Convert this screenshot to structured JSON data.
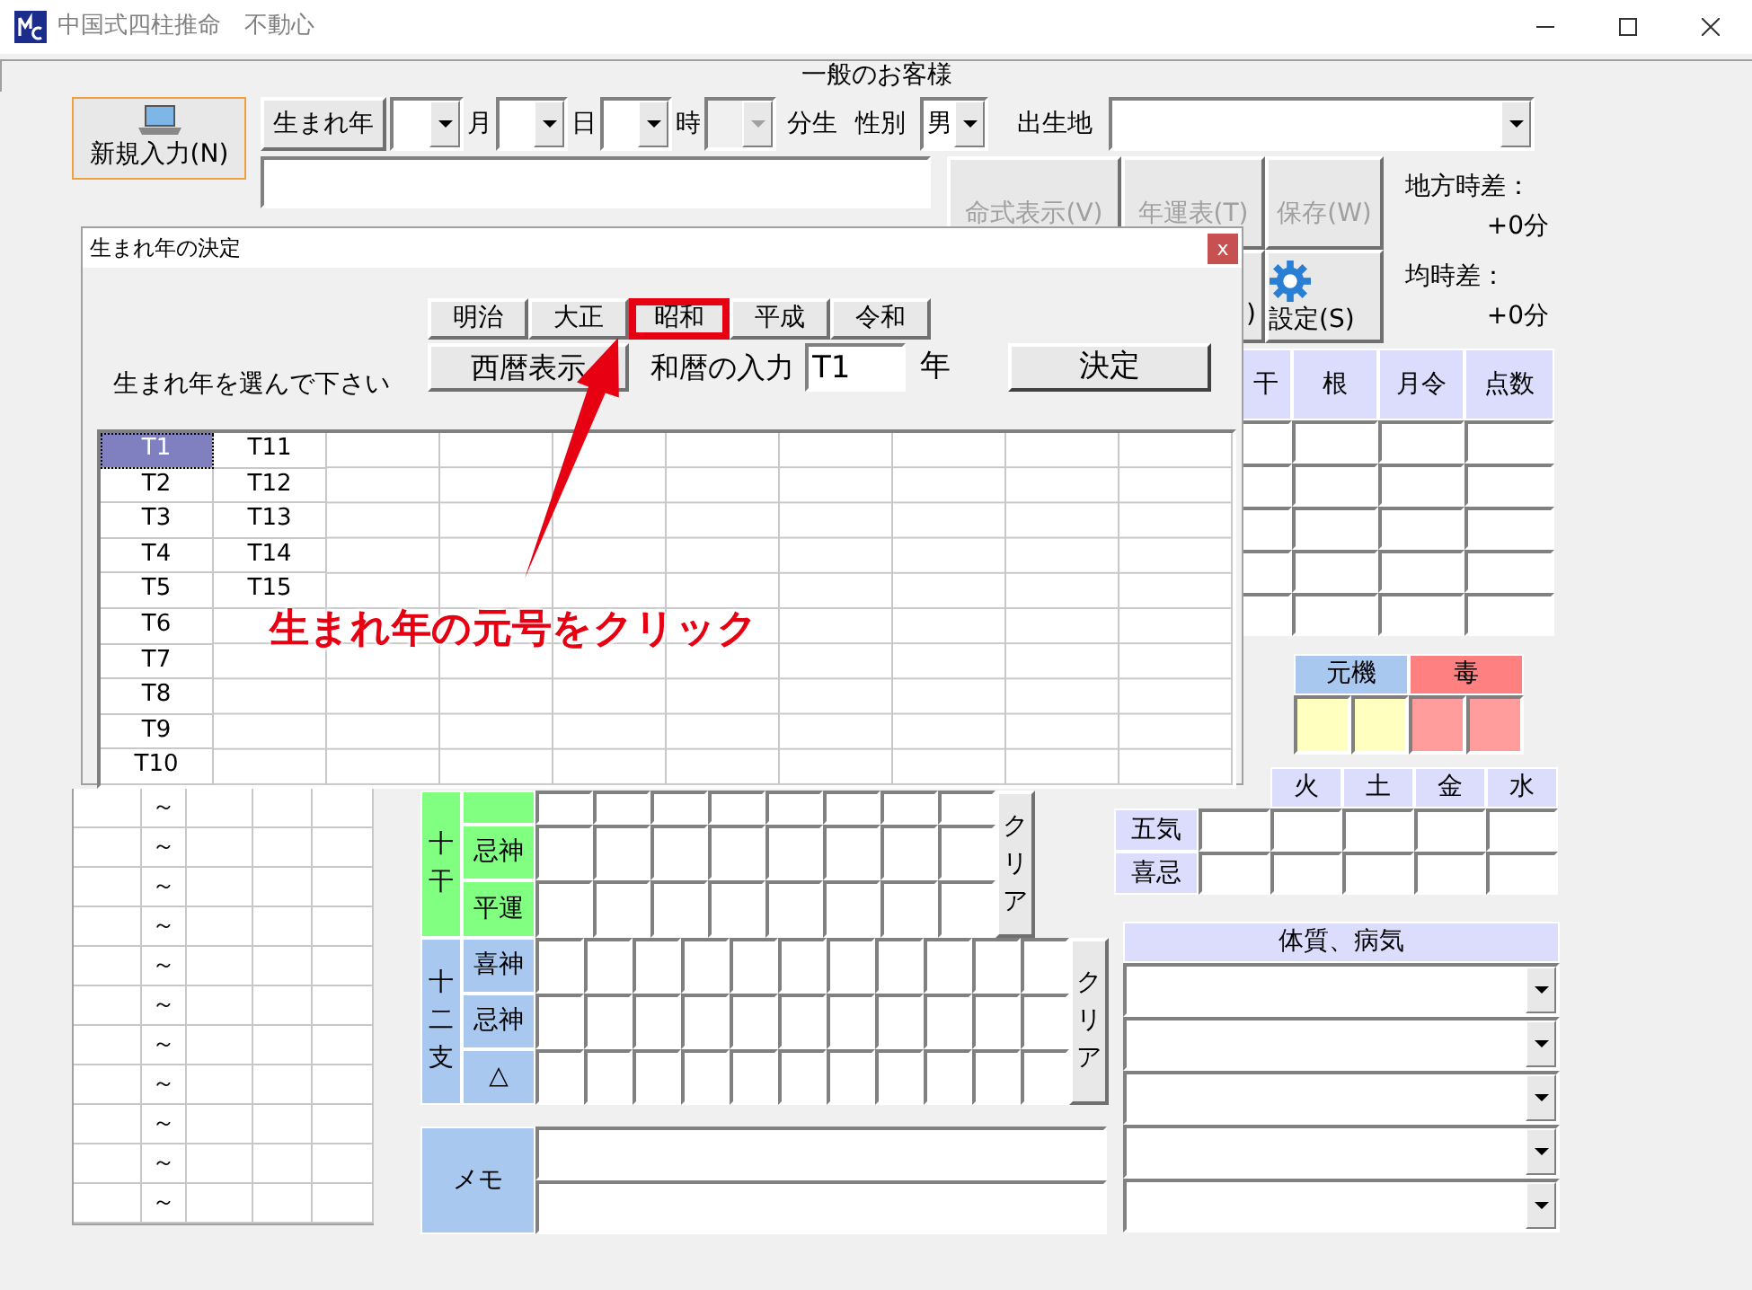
{
  "window": {
    "title": "中国式四柱推命　不動心"
  },
  "header": {
    "customer_type": "一般のお客様"
  },
  "new_button": {
    "label": "新規入力(N)"
  },
  "birth_row": [
    {
      "kind": "button",
      "label": "生まれ年"
    },
    {
      "kind": "combo",
      "disabled": false
    },
    {
      "kind": "label",
      "text": "月"
    },
    {
      "kind": "combo",
      "disabled": false
    },
    {
      "kind": "label",
      "text": "日"
    },
    {
      "kind": "combo",
      "disabled": false
    },
    {
      "kind": "label",
      "text": "時"
    },
    {
      "kind": "combo",
      "disabled": true
    },
    {
      "kind": "label",
      "text": "分生"
    },
    {
      "kind": "label",
      "text": "性別"
    },
    {
      "kind": "combo",
      "disabled": false,
      "value": "男"
    },
    {
      "kind": "label",
      "text": "出生地"
    },
    {
      "kind": "combo",
      "disabled": false
    }
  ],
  "toolbar": [
    {
      "kind": "button",
      "label": "命式表示(V)",
      "disabled": true
    },
    {
      "kind": "button",
      "label": "年運表(T)",
      "disabled": true
    },
    {
      "kind": "button",
      "label": "保存(W)",
      "disabled": true
    },
    {
      "kind": "button",
      "label": ")",
      "disabled": false
    },
    {
      "kind": "icon_button",
      "label": "設定(S)",
      "disabled": false
    }
  ],
  "time_diff": [
    {
      "label": "地方時差：",
      "value": "+0分"
    },
    {
      "label": "均時差：",
      "value": "+0分"
    }
  ],
  "pillar_table": {
    "columns": [
      "干",
      "根",
      "月令",
      "点数"
    ]
  },
  "genki": {
    "headers": [
      {
        "label": "元機",
        "color": "#a8c8f0"
      },
      {
        "label": "毒",
        "color": "#ff8080"
      }
    ],
    "cells": [
      {
        "color": "#ffffc0"
      },
      {
        "color": "#ffffc0"
      },
      {
        "color": "#ff9c9c"
      },
      {
        "color": "#ff9c9c"
      }
    ]
  },
  "five_elements": {
    "columns": [
      "火",
      "土",
      "金",
      "水"
    ],
    "rows": [
      "五気",
      "喜忌"
    ]
  },
  "constitution": {
    "title": "体質、病気"
  },
  "left_list": {
    "rows": [
      "～",
      "～",
      "～",
      "～",
      "～",
      "～",
      "～",
      "～",
      "～",
      "～",
      "～"
    ]
  },
  "stems": {
    "label": "十干",
    "color": "#80ff80",
    "rows": [
      "忌神",
      "平運"
    ],
    "clear_button": "クリア"
  },
  "branches": {
    "label": "十二支",
    "color": "#a8c8f0",
    "rows": [
      "喜神",
      "忌神",
      "△"
    ],
    "clear_button": "クリア"
  },
  "memo": {
    "label": "メモ"
  },
  "dialog": {
    "title": "生まれ年の決定",
    "close": "x",
    "prompt": "生まれ年を選んで下さい",
    "eras": [
      {
        "label": "明治",
        "highlighted": false
      },
      {
        "label": "大正",
        "highlighted": false
      },
      {
        "label": "昭和",
        "highlighted": true
      },
      {
        "label": "平成",
        "highlighted": false
      },
      {
        "label": "令和",
        "highlighted": false
      }
    ],
    "western_button": "西暦表示",
    "input_label": "和暦の入力",
    "input_value": "T1",
    "year_suffix": "年",
    "ok_button": "決定",
    "years": [
      {
        "label": "T1",
        "selected": true
      },
      {
        "label": "T2",
        "selected": false
      },
      {
        "label": "T3",
        "selected": false
      },
      {
        "label": "T4",
        "selected": false
      },
      {
        "label": "T5",
        "selected": false
      },
      {
        "label": "T6",
        "selected": false
      },
      {
        "label": "T7",
        "selected": false
      },
      {
        "label": "T8",
        "selected": false
      },
      {
        "label": "T9",
        "selected": false
      },
      {
        "label": "T10",
        "selected": false
      },
      {
        "label": "T11",
        "selected": false
      },
      {
        "label": "T12",
        "selected": false
      },
      {
        "label": "T13",
        "selected": false
      },
      {
        "label": "T14",
        "selected": false
      },
      {
        "label": "T15",
        "selected": false
      }
    ]
  },
  "annotation": {
    "text": "生まれ年の元号をクリック"
  }
}
